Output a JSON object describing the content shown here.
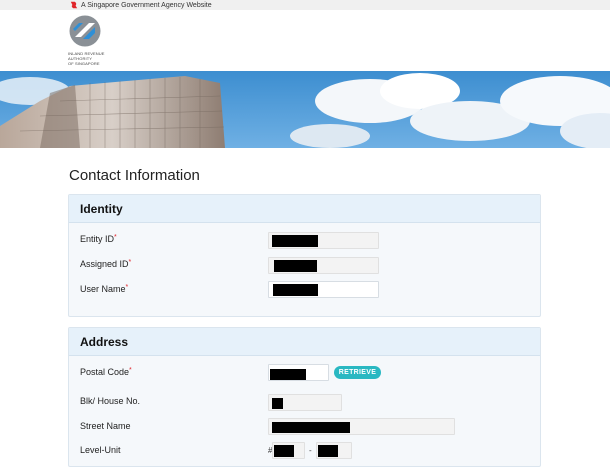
{
  "gov_banner": {
    "text": "A Singapore Government Agency Website"
  },
  "logo": {
    "line1": "INLAND REVENUE",
    "line2": "AUTHORITY",
    "line3": "OF SINGAPORE"
  },
  "page": {
    "title": "Contact Information"
  },
  "identity": {
    "heading": "Identity",
    "fields": [
      {
        "label": "Entity ID",
        "required": "*"
      },
      {
        "label": "Assigned ID",
        "required": "*"
      },
      {
        "label": "User Name",
        "required": "*"
      }
    ]
  },
  "address": {
    "heading": "Address",
    "fields": [
      {
        "label": "Postal Code",
        "required": "*"
      },
      {
        "label": "Blk/ House No.",
        "required": ""
      },
      {
        "label": "Street Name",
        "required": ""
      },
      {
        "label": "Level-Unit",
        "required": ""
      }
    ],
    "retrieve_label": "RETRIEVE",
    "unit_prefix": "#",
    "unit_separator": "-"
  },
  "colors": {
    "accent": "#29b8c2",
    "required": "#e0262b",
    "panel_head": "#e6f1fa"
  }
}
